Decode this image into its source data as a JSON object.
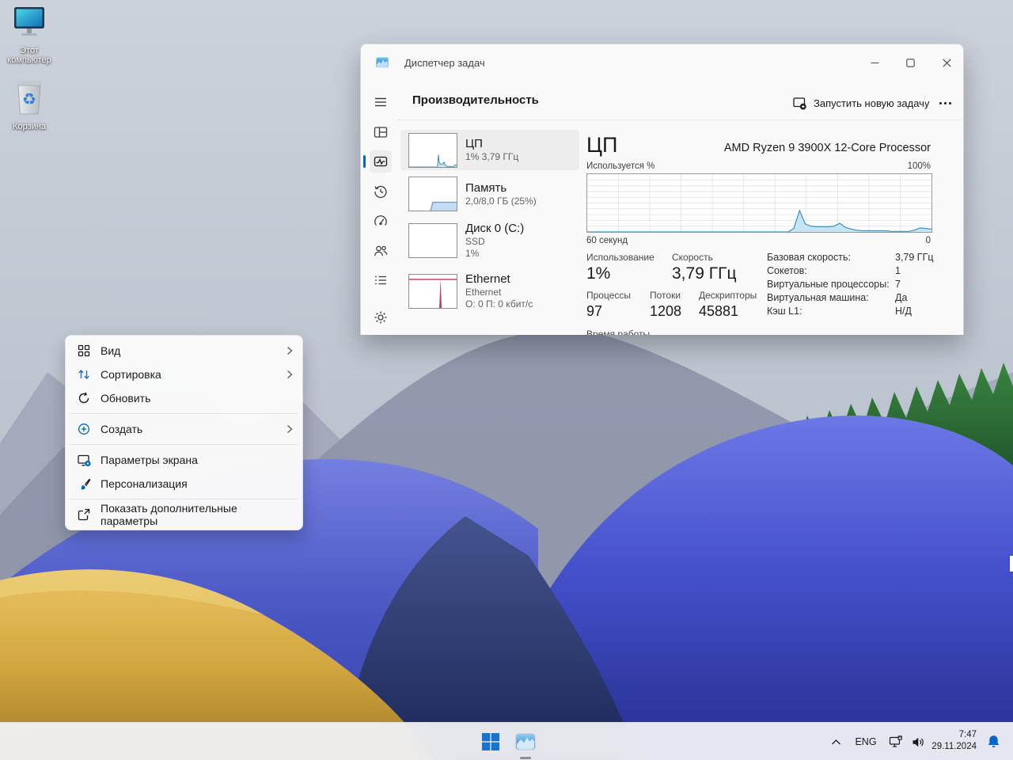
{
  "colors": {
    "accent": "#0067C0",
    "chart_stroke": "#3E8FBE",
    "chart_fill": "#C6E4F3",
    "chart_grid": "#E6E6E6",
    "chart_border": "#9A9A9A",
    "ethernet": "#B9496B",
    "memory_fill": "#C3DCF3",
    "memory_stroke": "#6A99D8"
  },
  "desktop": {
    "icons": [
      {
        "label": "Этот компьютер"
      },
      {
        "label": "Корзина"
      }
    ]
  },
  "context_menu": {
    "items": [
      {
        "label": "Вид"
      },
      {
        "label": "Сортировка"
      },
      {
        "label": "Обновить"
      },
      {
        "label": "Создать"
      },
      {
        "label": "Параметры экрана"
      },
      {
        "label": "Персонализация"
      },
      {
        "label": "Показать дополнительные параметры"
      }
    ]
  },
  "task_manager": {
    "window_title": "Диспетчер задач",
    "page_title": "Производительность",
    "run_new_task_label": "Запустить новую задачу",
    "list": [
      {
        "name": "ЦП",
        "line2": "1% 3,79 ГГц",
        "line3": ""
      },
      {
        "name": "Память",
        "line2": "2,0/8,0 ГБ (25%)",
        "line3": ""
      },
      {
        "name": "Диск 0 (C:)",
        "line2": "SSD",
        "line3": "1%"
      },
      {
        "name": "Ethernet",
        "line2": "Ethernet",
        "line3": "О: 0 П: 0 кбит/с"
      }
    ],
    "cpu": {
      "title": "ЦП",
      "processor": "AMD Ryzen 9 3900X 12-Core Processor",
      "graph_label": "Используется %",
      "graph_max": "100%",
      "graph_time": "60 секунд",
      "graph_zero": "0",
      "stats": [
        {
          "label": "Использование",
          "value": "1%"
        },
        {
          "label": "Скорость",
          "value": "3,79 ГГц"
        },
        {
          "label": "Процессы",
          "value": "97"
        },
        {
          "label": "Потоки",
          "value": "1208"
        },
        {
          "label": "Дескрипторы",
          "value": "45881"
        }
      ],
      "uptime_label": "Время работы",
      "details": [
        {
          "label": "Базовая скорость:",
          "value": "3,79 ГГц"
        },
        {
          "label": "Сокетов:",
          "value": "1"
        },
        {
          "label": "Виртуальные процессоры:",
          "value": "7"
        },
        {
          "label": "Виртуальная машина:",
          "value": "Да"
        },
        {
          "label": "Кэш L1:",
          "value": "Н/Д"
        }
      ]
    }
  },
  "taskbar": {
    "language": "ENG",
    "time": "7:47",
    "date": "29.11.2024"
  },
  "chart_data": {
    "type": "area",
    "title": "ЦП — Используется %",
    "ylim": [
      0,
      100
    ],
    "ylabel_top": "100%",
    "xlabel_left": "60 секунд",
    "xlabel_right": "0",
    "grid": true,
    "series": [
      {
        "name": "CPU usage %",
        "values": [
          0,
          0,
          0,
          0,
          0,
          0,
          0,
          0,
          0,
          0,
          0,
          0,
          0,
          0,
          0,
          0,
          0,
          0,
          0,
          0,
          0,
          0,
          0,
          0,
          0,
          0,
          0,
          0,
          0,
          0,
          0,
          0,
          0,
          0,
          0,
          0,
          6,
          37,
          14,
          10,
          9,
          9,
          9,
          10,
          15,
          8,
          5,
          3,
          2,
          2,
          2,
          2,
          2,
          1,
          1,
          1,
          1,
          3,
          7,
          6,
          5
        ]
      }
    ],
    "mini_memory": {
      "start_pct": 45,
      "height_pct": 25
    },
    "mini_ethernet": {
      "spike_x_pct": 66,
      "spike_height_pct": 86,
      "top_line_y_pct": 14
    }
  }
}
